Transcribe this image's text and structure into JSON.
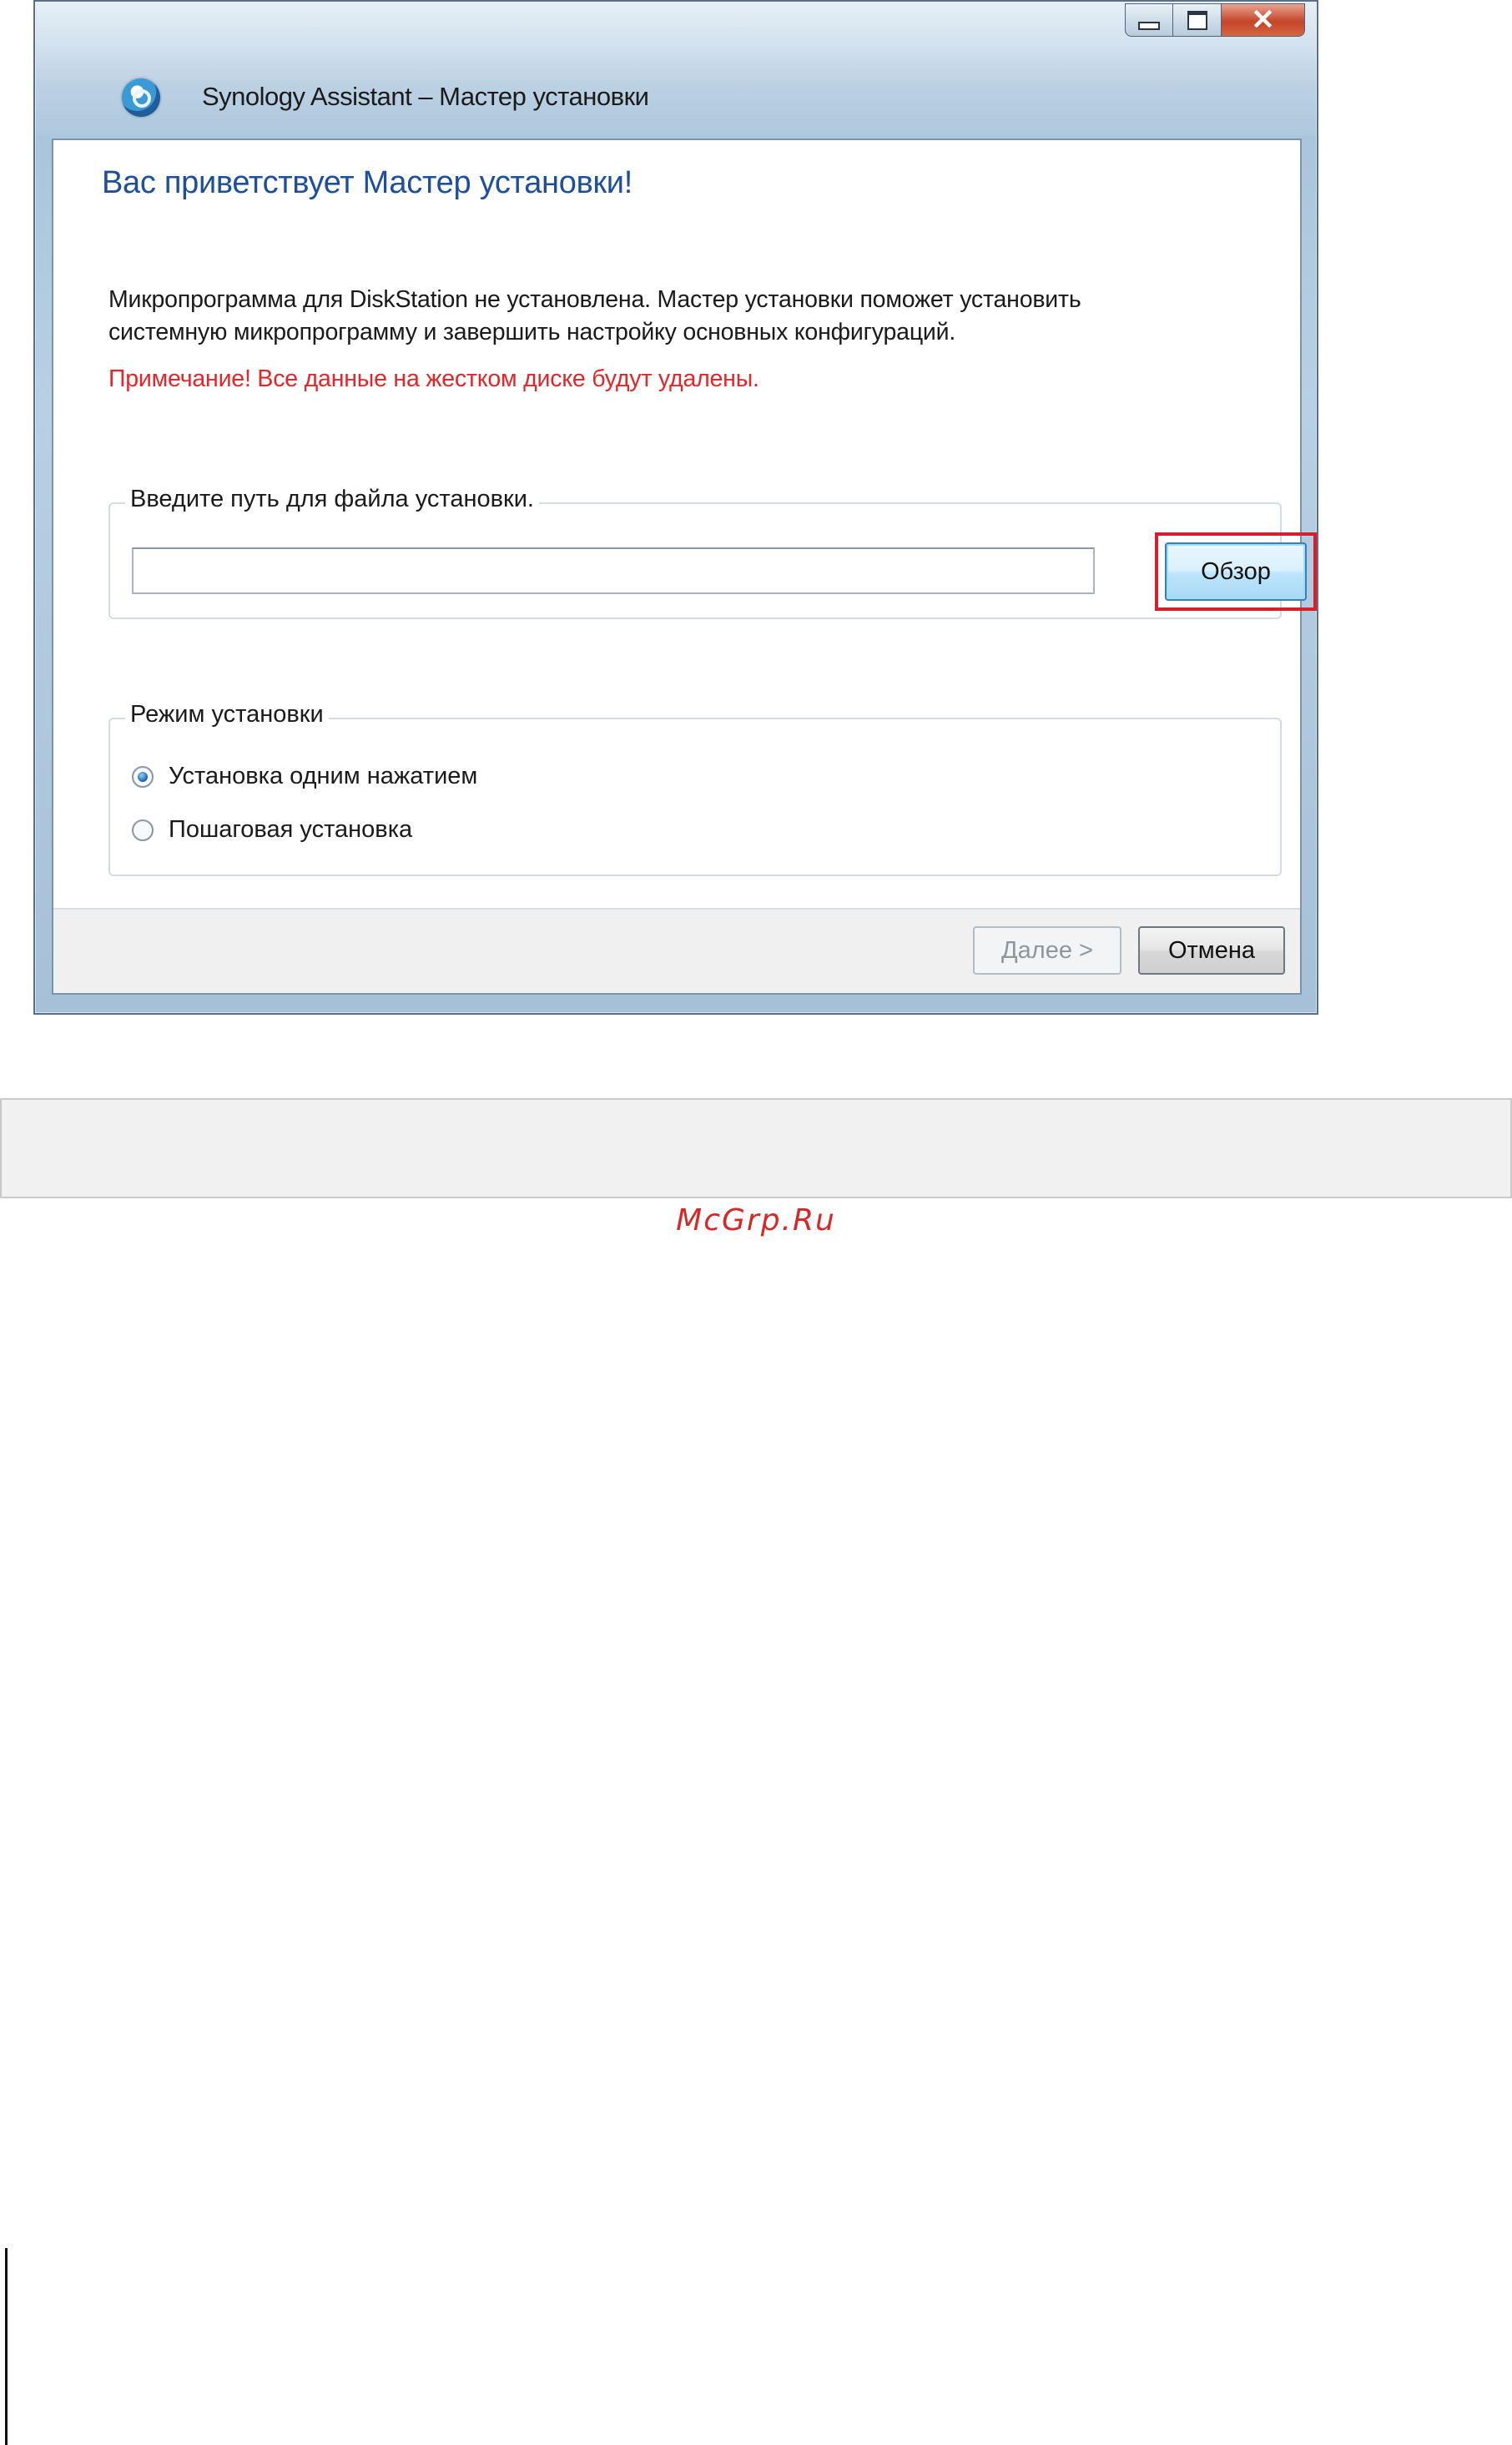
{
  "window": {
    "title": "Synology Assistant – Мастер установки",
    "icon": "synology-assistant-icon",
    "controls": {
      "minimize_icon": "minimize-icon",
      "maximize_icon": "maximize-icon",
      "close_glyph": "✕"
    }
  },
  "wizard": {
    "heading": "Вас приветствует Мастер установки!",
    "message_line1": "Микропрограмма для DiskStation не установлена. Мастер установки поможет установить",
    "message_line2": "системную микропрограмму и завершить настройку основных конфигураций.",
    "note": "Примечание! Все данные на жестком диске будут удалены.",
    "path_group": {
      "label": "Введите путь для файла установки.",
      "input_value": "",
      "browse_label": "Обзор"
    },
    "mode_group": {
      "label": "Режим установки",
      "options": [
        {
          "label": "Установка одним нажатием",
          "selected": true
        },
        {
          "label": "Пошаговая установка",
          "selected": false
        }
      ]
    },
    "footer": {
      "next_label": "Далее >",
      "next_enabled": false,
      "cancel_label": "Отмена"
    }
  },
  "page": {
    "watermark": "McGrp.Ru"
  },
  "colors": {
    "heading": "#1d4f9a",
    "note": "#e3262a",
    "highlight_box": "#d61f2a",
    "watermark": "#d62828"
  }
}
